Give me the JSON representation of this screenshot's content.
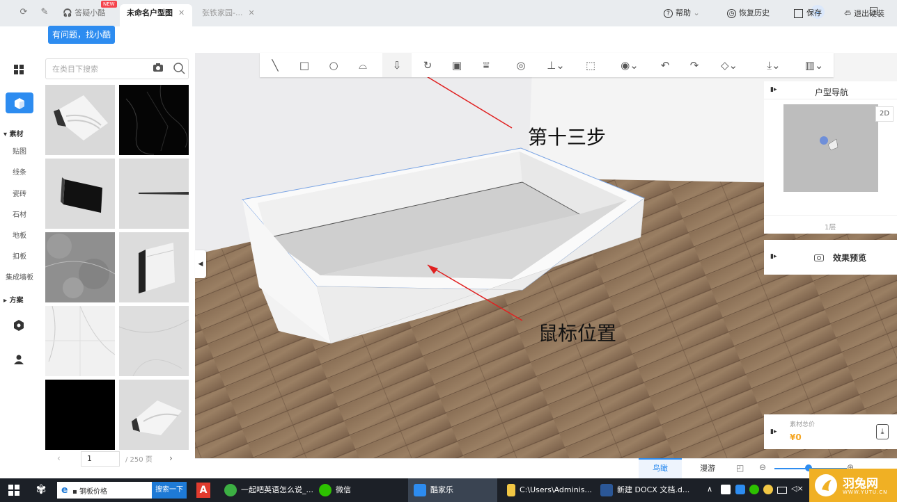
{
  "titlebar": {
    "tabs": [
      {
        "label": "答疑小酷",
        "badge": "NEW"
      },
      {
        "label": "未命名户型图"
      },
      {
        "label": "张铁家园-..."
      }
    ],
    "help_tip": "有问题，找小酷"
  },
  "topbar": {
    "help": "帮助",
    "restore": "恢复历史",
    "save": "保存",
    "exit": "退出硬装"
  },
  "leftnav": {
    "section_material": "素材",
    "items": [
      "贴图",
      "线条",
      "瓷砖",
      "石材",
      "地板",
      "扣板",
      "集成墙板"
    ],
    "section_plan": "方案"
  },
  "catalog": {
    "search_placeholder": "在类目下搜索",
    "page_current": "1",
    "page_total": "/ 250 页",
    "thumbs": [
      "crown-molding",
      "black-marble",
      "black-tile",
      "metal-strip",
      "grey-marble",
      "baseboard",
      "white-marble",
      "light-marble",
      "black-panel",
      "crown-molding-2"
    ]
  },
  "right": {
    "nav_title": "户型导航",
    "mode_2d": "2D",
    "floor": "1层",
    "preview": "效果预览",
    "material_total_label": "素材总价",
    "material_total": "¥0"
  },
  "bottombar": {
    "birdseye": "鸟瞰",
    "roam": "漫游"
  },
  "annotations": {
    "step": "第十三步",
    "mouse": "鼠标位置"
  },
  "taskbar": {
    "search_value": "钢板价格",
    "search_button": "搜索一下",
    "items": [
      "一起吧英语怎么说_...",
      "微信",
      "酷家乐",
      "C:\\Users\\Adminis...",
      "新建 DOCX 文档.d..."
    ],
    "watermark_cn": "羽兔网",
    "watermark_url": "WWW.YUTU.CN"
  },
  "colors": {
    "accent": "#2d8cf0",
    "price": "#f5a623",
    "arrow": "#e02020"
  }
}
